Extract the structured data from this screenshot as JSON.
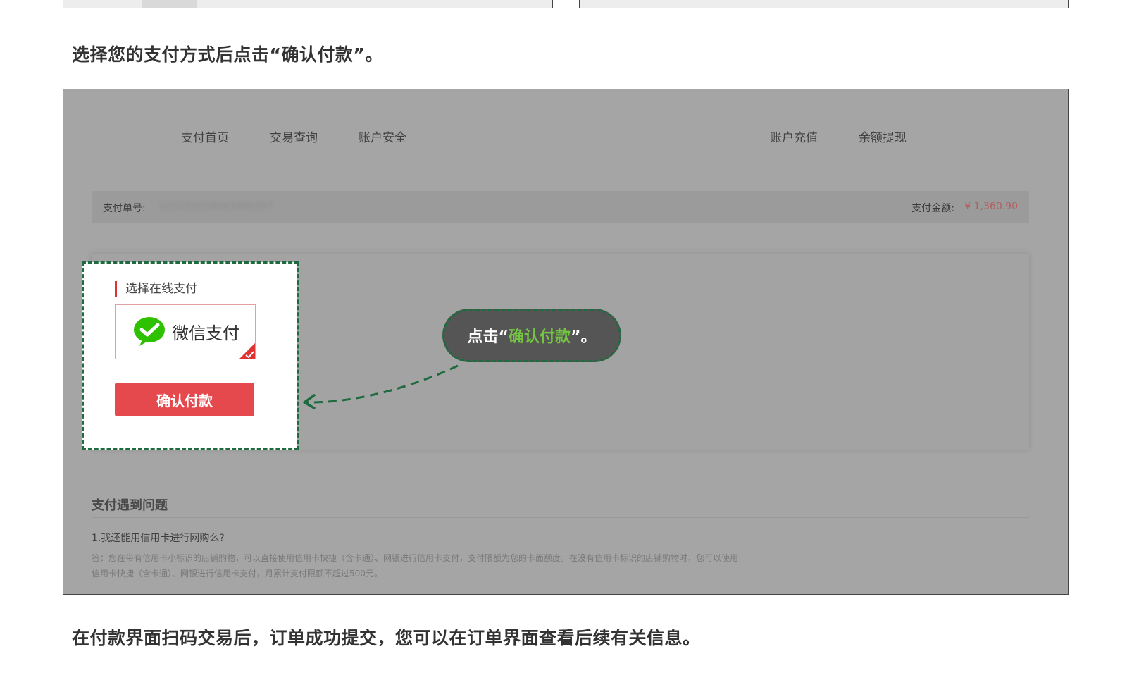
{
  "instructions": {
    "select_payment": "选择您的支付方式后点击“确认付款”。",
    "after_scan": "在付款界面扫码交易后，订单成功提交，您可以在订单界面查看后续有关信息。"
  },
  "nav": {
    "items": [
      "支付首页",
      "交易查询",
      "账户安全",
      "账户充值",
      "余额提现"
    ]
  },
  "order": {
    "number_label": "支付单号:",
    "number_value": "U202310180434003​97",
    "amount_label": "支付金额:",
    "amount_value": "¥ 1,360.90"
  },
  "payment": {
    "section_title": "选择在线支付",
    "method_label": "微信支付",
    "method_icon": "wechat-icon",
    "confirm_label": "确认付款"
  },
  "callout": {
    "prefix": "点击“",
    "highlight": "确认付款",
    "suffix": "”。"
  },
  "faq": {
    "title": "支付遇到问题",
    "question": "1.我还能用信用卡进行网购么?",
    "answer": "答：您在带有信用卡小标识的店铺购物，可以直接使用信用卡快捷（含卡通）、网银进行信用卡支付，支付限额为您的卡面额度。在没有信用卡标识的店铺购物时，您可以使用信用卡快捷（含卡通）、网银进行信用卡支付，月累计支付限额不超过500元。"
  },
  "colors": {
    "accent_red": "#e5484d",
    "callout_green": "#74c642",
    "dash_green": "#1d6b3e",
    "overlay_gray": "#a5a5a5"
  }
}
